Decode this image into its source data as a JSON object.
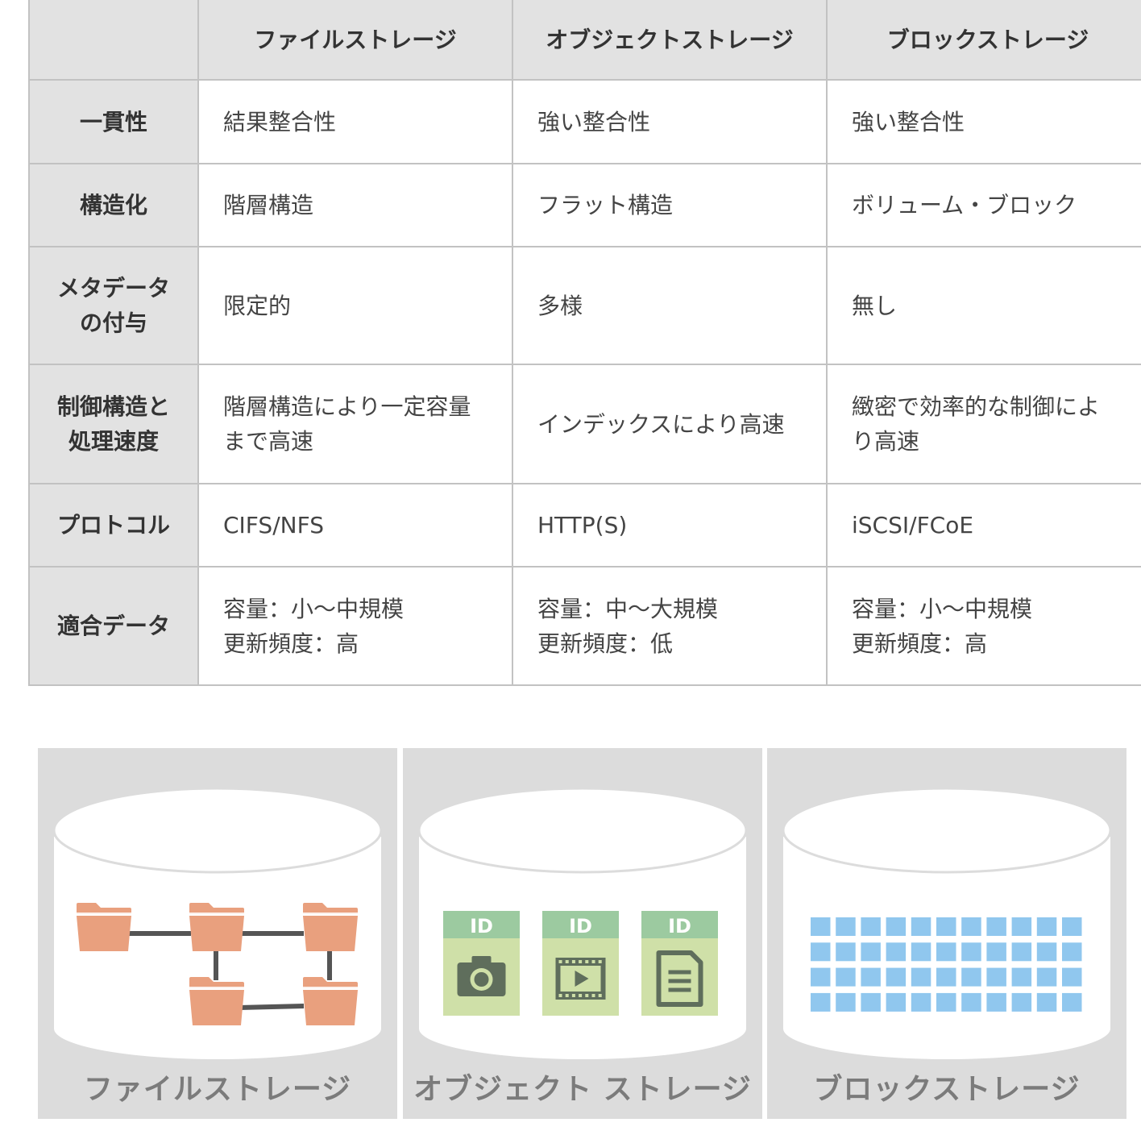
{
  "table": {
    "headers": [
      "",
      "ファイルストレージ",
      "オブジェクトストレージ",
      "ブロックストレージ"
    ],
    "rows": [
      {
        "label": "一貫性",
        "cells": [
          "結果整合性",
          "強い整合性",
          "強い整合性"
        ]
      },
      {
        "label": "構造化",
        "cells": [
          "階層構造",
          "フラット構造",
          "ボリューム・ブロック"
        ]
      },
      {
        "label": "メタデータ\nの付与",
        "cells": [
          "限定的",
          "多様",
          "無し"
        ]
      },
      {
        "label": "制御構造と\n処理速度",
        "cells": [
          "階層構造により一定容量\nまで高速",
          "インデックスにより高速",
          "緻密で効率的な制御によ\nり高速"
        ]
      },
      {
        "label": "プロトコル",
        "cells": [
          "CIFS/NFS",
          "HTTP(S)",
          "iSCSI/FCoE"
        ]
      },
      {
        "label": "適合データ",
        "cells": [
          "容量：小〜中規模\n更新頻度：高",
          "容量：中〜大規模\n更新頻度：低",
          "容量：小〜中規模\n更新頻度：高"
        ]
      }
    ]
  },
  "diagrams": {
    "file": {
      "label": "ファイルストレージ",
      "folder_color": "#e9a07e",
      "link_color": "#555555"
    },
    "object": {
      "label": "オブジェクト ストレージ",
      "card_color": "#cfe0a8",
      "tag_color": "#9ccaa0",
      "icon_color": "#5f6e5c",
      "items": [
        {
          "tag": "ID",
          "icon": "camera-icon"
        },
        {
          "tag": "ID",
          "icon": "film-play-icon"
        },
        {
          "tag": "ID",
          "icon": "document-icon"
        }
      ]
    },
    "block": {
      "label": "ブロックストレージ",
      "block_color": "#90c7ee",
      "block_rows": 4,
      "block_cols": 11
    }
  }
}
